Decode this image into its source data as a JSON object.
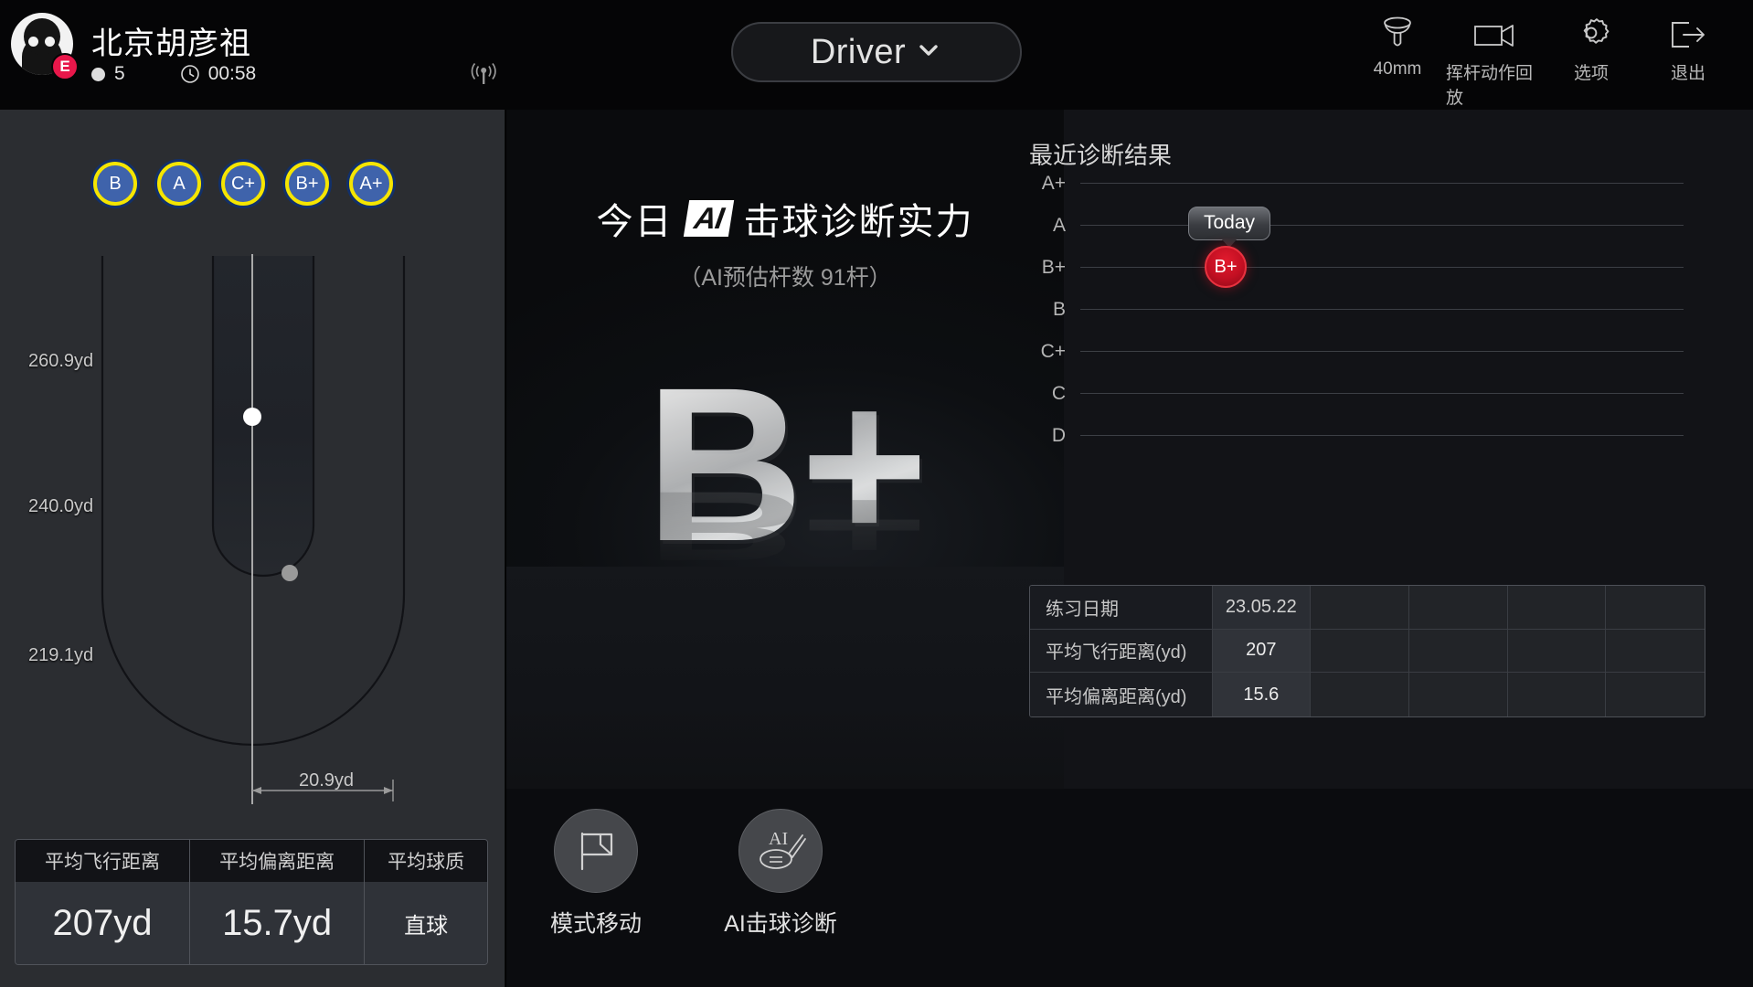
{
  "topbar": {
    "user_name": "北京胡彦祖",
    "level_badge": "E",
    "ball_count": "5",
    "timer": "00:58",
    "signal_icon": "signal-icon",
    "club": {
      "label": "Driver",
      "chevron_icon": "chevron-down-icon"
    },
    "actions": [
      {
        "icon": "golf-tee-icon",
        "label": "40mm"
      },
      {
        "icon": "video-camera-icon",
        "label": "挥杆动作回放"
      },
      {
        "icon": "gear-icon",
        "label": "选项"
      },
      {
        "icon": "exit-icon",
        "label": "退出"
      }
    ]
  },
  "left": {
    "grade_badges": [
      "B",
      "A",
      "C+",
      "B+",
      "A+"
    ],
    "distance_labels": [
      "260.9yd",
      "240.0yd",
      "219.1yd"
    ],
    "deviation_label": "20.9yd",
    "stats": [
      {
        "header": "平均飞行距离",
        "value": "207yd",
        "size": "big"
      },
      {
        "header": "平均偏离距离",
        "value": "15.7yd",
        "size": "big"
      },
      {
        "header": "平均球质",
        "value": "直球",
        "size": "small"
      }
    ]
  },
  "center": {
    "title_prefix": "今日",
    "ai_chip": "AI",
    "title_suffix": "击球诊断实力",
    "subtitle": "（AI预估杆数 91杆）",
    "big_grade": "B+"
  },
  "right": {
    "chart_title": "最近诊断结果",
    "today_tooltip": "Today",
    "today_value": "B+",
    "history_table": {
      "rows": [
        {
          "label": "练习日期",
          "value": "23.05.22",
          "empty_cells": 4
        },
        {
          "label": "平均飞行距离(yd)",
          "value": "207",
          "empty_cells": 4
        },
        {
          "label": "平均偏离距离(yd)",
          "value": "15.6",
          "empty_cells": 4
        }
      ]
    }
  },
  "bottom": {
    "actions": [
      {
        "icon": "flag-icon",
        "label": "模式移动"
      },
      {
        "icon": "ai-driver-icon",
        "label": "AI击球诊断"
      }
    ]
  },
  "chart_data": {
    "type": "scatter",
    "title": "最近诊断结果",
    "categories": [
      "A+",
      "A",
      "B+",
      "B",
      "C+",
      "C",
      "D"
    ],
    "ylabel": "",
    "xlabel": "",
    "grid": true,
    "legend": "none",
    "points": [
      {
        "x_label": "Today",
        "y_label": "B+",
        "color": "#c6122a"
      }
    ],
    "colors": {
      "accent": "#c6122a",
      "grid": "#3c3f45",
      "tick": "#b5b5b5"
    }
  }
}
